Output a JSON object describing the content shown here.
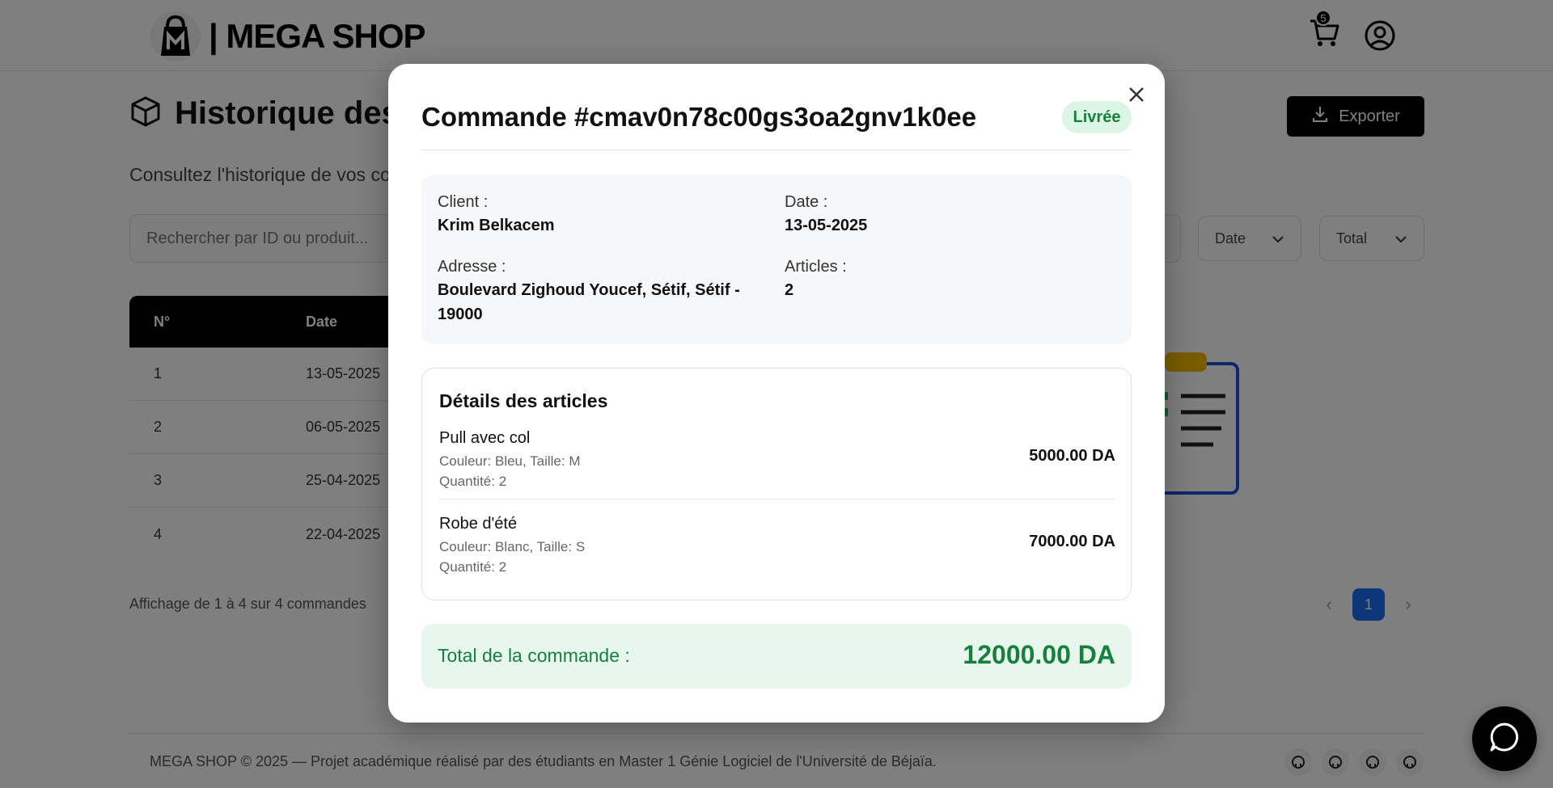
{
  "header": {
    "brand": "| MEGA SHOP",
    "cart_count": "5"
  },
  "page": {
    "title": "Historique des Commandes",
    "subtitle": "Consultez l'historique de vos commandes",
    "export_label": "Exporter",
    "search_placeholder": "Rechercher par ID ou produit...",
    "filter_date": "Date",
    "filter_total": "Total",
    "table": {
      "headers": [
        "N°",
        "Date"
      ],
      "rows": [
        {
          "n": "1",
          "date": "13-05-2025"
        },
        {
          "n": "2",
          "date": "06-05-2025"
        },
        {
          "n": "3",
          "date": "25-04-2025"
        },
        {
          "n": "4",
          "date": "22-04-2025"
        }
      ]
    },
    "pagination_info": "Affichage de 1 à 4 sur 4 commandes",
    "current_page": "1"
  },
  "footer": {
    "text": "MEGA SHOP © 2025 — Projet académique réalisé par des étudiants en Master 1 Génie Logiciel de l'Université de Béjaïa."
  },
  "modal": {
    "title": "Commande #cmav0n78c00gs3oa2gnv1k0ee",
    "status": "Livrée",
    "client_label": "Client :",
    "client_value": "Krim Belkacem",
    "date_label": "Date :",
    "date_value": "13-05-2025",
    "address_label": "Adresse :",
    "address_value": "Boulevard Zighoud Youcef, Sétif, Sétif - 19000",
    "articles_label": "Articles :",
    "articles_value": "2",
    "items_title": "Détails des articles",
    "items": [
      {
        "name": "Pull avec col",
        "attributes": "Couleur: Bleu, Taille: M",
        "quantity": "Quantité: 2",
        "price": "5000.00 DA"
      },
      {
        "name": "Robe d'été",
        "attributes": "Couleur: Blanc, Taille: S",
        "quantity": "Quantité: 2",
        "price": "7000.00 DA"
      }
    ],
    "total_label": "Total de la commande :",
    "total_value": "12000.00 DA"
  },
  "colors": {
    "overlay": "rgba(0,0,0,0.5)",
    "status_green": "#16803c",
    "status_bg": "#dcf5e4",
    "pager_blue": "#1d6ff2"
  }
}
